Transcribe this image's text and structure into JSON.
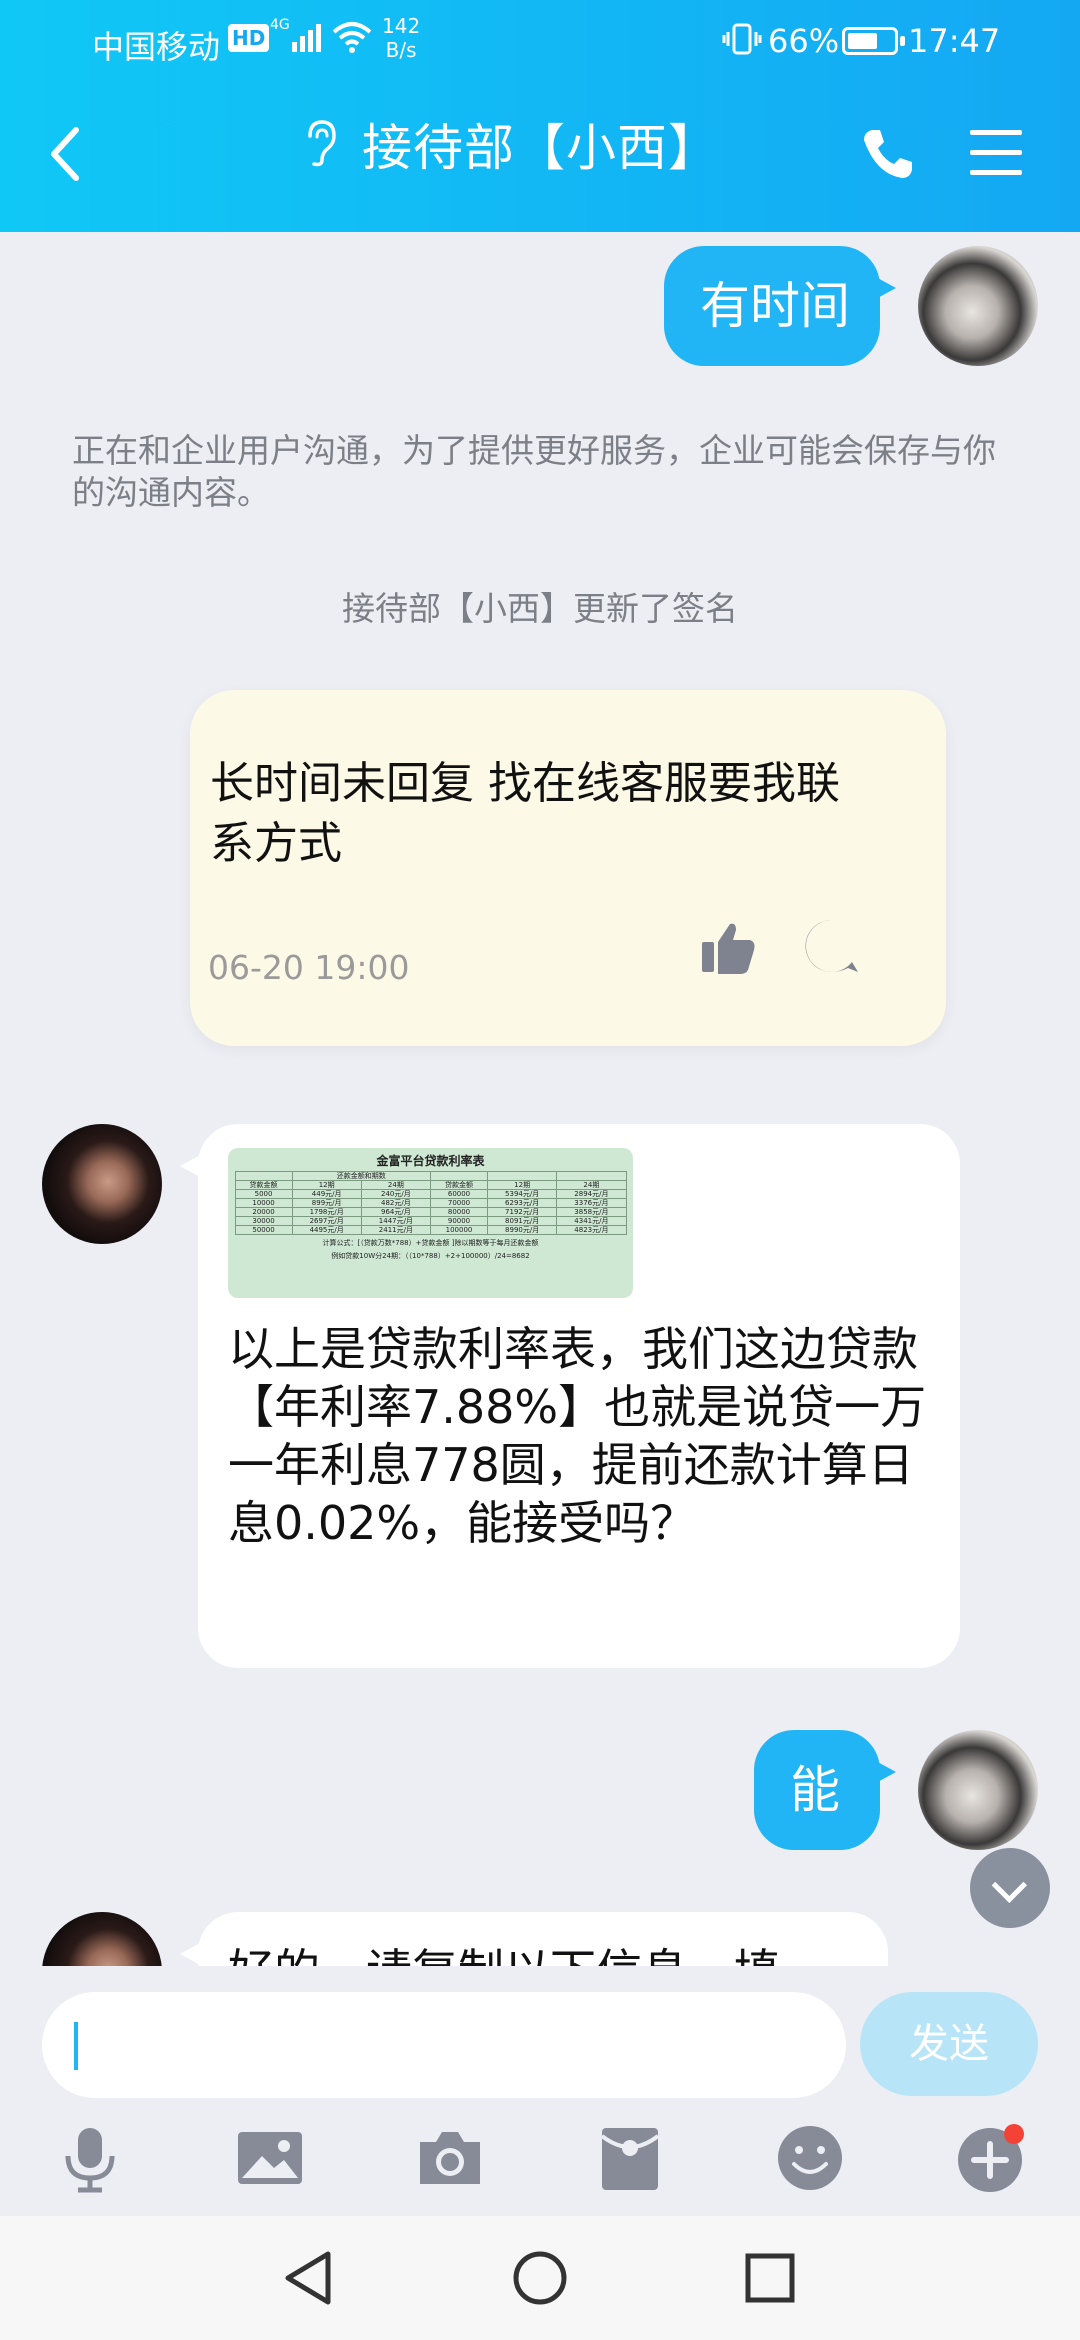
{
  "status": {
    "carrier": "中国移动",
    "hd": "HD",
    "net_type": "4G",
    "speed_value": "142",
    "speed_unit": "B/s",
    "battery": "66%",
    "battery_level_percent": 66,
    "time": "17:47"
  },
  "header": {
    "title": "接待部【小西】"
  },
  "messages": {
    "m1_text": "有时间",
    "system_notice": "正在和企业用户沟通，为了提供更好服务，企业可能会保存与你的沟通内容。",
    "signature_update": "接待部【小西】更新了签名",
    "signature_text": "长时间未回复 找在线客服要我联系方式",
    "signature_time": "06-20 19:00",
    "m3_text": "以上是贷款利率表，我们这边贷款【年利率7.88%】也就是说贷一万 一年利息778圆，提前还款计算日息0.02%，能接受吗？",
    "m4_text": "能",
    "m5_partial": "好的，请复制以下信息，填"
  },
  "rate_table": {
    "title": "金富平台贷款利率表",
    "header_group": "还款金额和期数",
    "headers": [
      "贷款金额",
      "12期",
      "24期",
      "贷款金额",
      "12期",
      "24期"
    ],
    "rows": [
      [
        "5000",
        "449元/月",
        "240元/月",
        "60000",
        "5394元/月",
        "2894元/月"
      ],
      [
        "10000",
        "899元/月",
        "482元/月",
        "70000",
        "6293元/月",
        "3376元/月"
      ],
      [
        "20000",
        "1798元/月",
        "964元/月",
        "80000",
        "7192元/月",
        "3858元/月"
      ],
      [
        "30000",
        "2697元/月",
        "1447元/月",
        "90000",
        "8091元/月",
        "4341元/月"
      ],
      [
        "50000",
        "4495元/月",
        "2411元/月",
        "100000",
        "8990元/月",
        "4823元/月"
      ]
    ],
    "formula": "计算公式：[（贷款万数*788）+贷款金额 ]除以期数等于每月还款金额",
    "example": "例如贷款10W分24期：（（10*788）+2+100000）/24=8682"
  },
  "input": {
    "value": "",
    "send_label": "发送"
  },
  "colors": {
    "header_start": "#10c8f6",
    "header_end": "#14a8f3",
    "bubble_blue": "#22b5f5",
    "notice_bg": "#fcf9e6",
    "background": "#eceef4"
  }
}
